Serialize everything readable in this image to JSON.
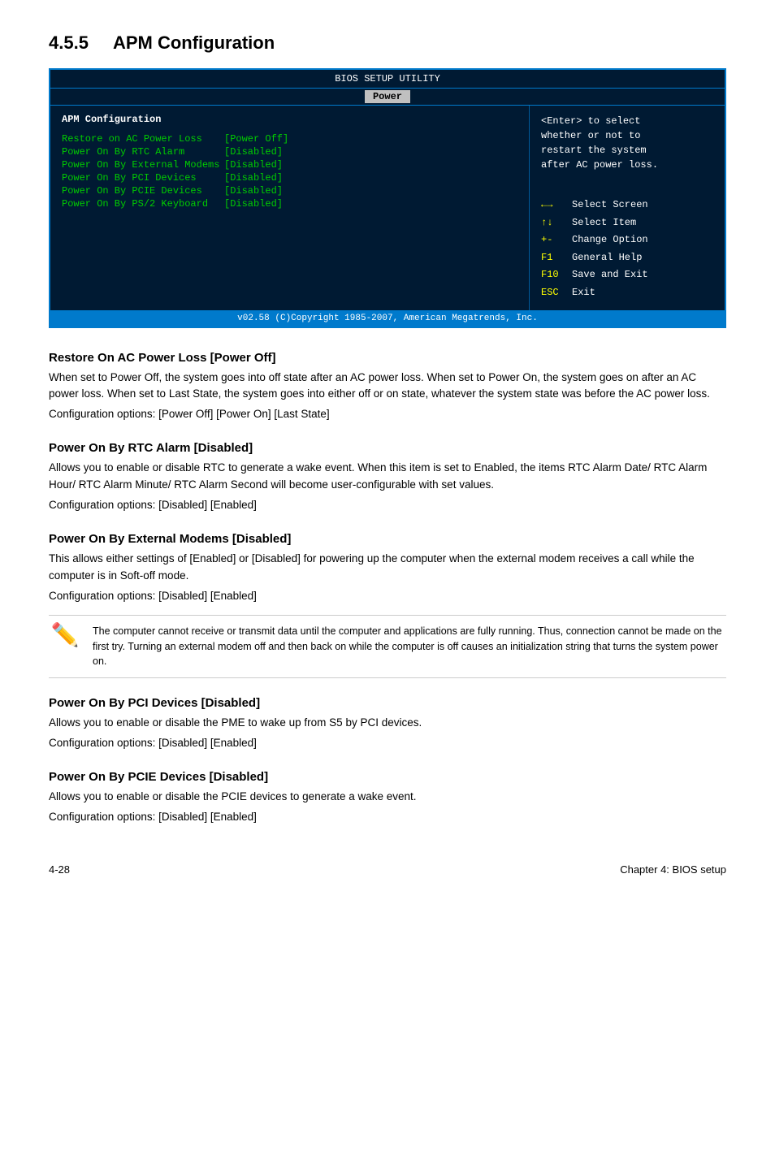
{
  "section": {
    "number": "4.5.5",
    "title": "APM Configuration"
  },
  "bios": {
    "header": "BIOS SETUP UTILITY",
    "tab": "Power",
    "section_label": "APM Configuration",
    "items": [
      {
        "label": "Restore on AC Power Loss",
        "value": "[Power Off]"
      },
      {
        "label": "Power On By RTC Alarm",
        "value": "[Disabled]"
      },
      {
        "label": "Power On By External Modems",
        "value": "[Disabled]"
      },
      {
        "label": "Power On By PCI Devices",
        "value": "[Disabled]"
      },
      {
        "label": "Power On By PCIE Devices",
        "value": "[Disabled]"
      },
      {
        "label": "Power On By PS/2 Keyboard",
        "value": "[Disabled]"
      }
    ],
    "help": "<Enter> to select\nwhether or not to\nrestart the system\nafter AC power loss.",
    "keys": [
      {
        "sym": "↑↓",
        "desc": "Select Screen"
      },
      {
        "sym": "↑↓",
        "desc": "Select Item"
      },
      {
        "sym": "+-",
        "desc": "Change Option"
      },
      {
        "sym": "F1",
        "desc": "General Help"
      },
      {
        "sym": "F10",
        "desc": "Save and Exit"
      },
      {
        "sym": "ESC",
        "desc": "Exit"
      }
    ],
    "footer": "v02.58 (C)Copyright 1985-2007, American Megatrends, Inc."
  },
  "sections": [
    {
      "title": "Restore On AC Power Loss [Power Off]",
      "body": "When set to Power Off, the system goes into off state after an AC power loss. When set to Power On, the system goes on after an AC power loss. When set to Last State, the system goes into either off or on state, whatever the system state was before the AC power loss.",
      "config": "Configuration options: [Power Off] [Power On] [Last State]",
      "note": null
    },
    {
      "title": "Power On By RTC Alarm [Disabled]",
      "body": "Allows you to enable or disable RTC to generate a wake event. When this item is set to Enabled, the items RTC Alarm Date/ RTC Alarm Hour/ RTC Alarm Minute/ RTC Alarm Second will become user-configurable with set values.",
      "config": "Configuration options: [Disabled] [Enabled]",
      "note": null
    },
    {
      "title": "Power On By External Modems [Disabled]",
      "body": "This allows either settings of [Enabled] or [Disabled] for powering up the computer when the external modem receives a call while the computer is in Soft-off mode.",
      "config": "Configuration options: [Disabled] [Enabled]",
      "note": "The computer cannot receive or transmit data until the computer and applications are fully running. Thus, connection cannot be made on the first try. Turning an external modem off and then back on while the computer is off causes an initialization string that turns the system power on."
    },
    {
      "title": "Power On By PCI Devices [Disabled]",
      "body": "Allows you to enable or disable the PME to wake up from S5 by PCI devices.",
      "config": "Configuration options: [Disabled] [Enabled]",
      "note": null
    },
    {
      "title": "Power On By PCIE Devices [Disabled]",
      "body": "Allows you to enable or disable the PCIE devices to generate a wake event.",
      "config": "Configuration options: [Disabled] [Enabled]",
      "note": null
    }
  ],
  "footer": {
    "left": "4-28",
    "right": "Chapter 4: BIOS setup"
  }
}
